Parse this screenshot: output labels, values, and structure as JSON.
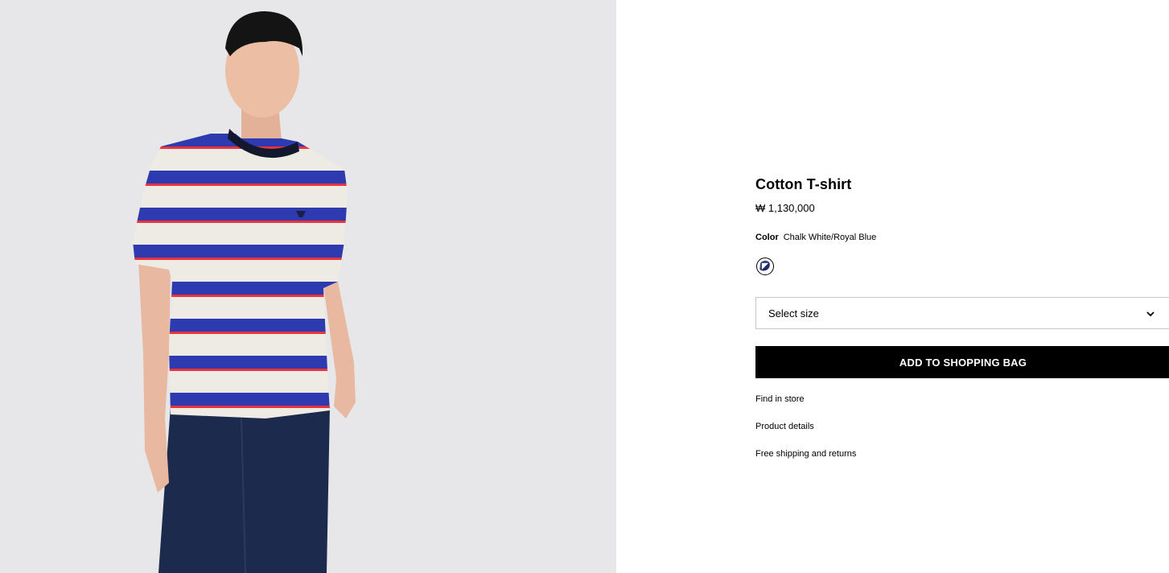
{
  "product": {
    "name": "Cotton T-shirt",
    "price": "₩ 1,130,000",
    "color_label": "Color",
    "color_value": "Chalk White/Royal Blue",
    "swatch_icon": "color-swatch-icon",
    "swatch_colors": [
      "#ffffff",
      "#1f2a6b"
    ]
  },
  "size_select": {
    "placeholder": "Select size",
    "icon": "chevron-down-icon"
  },
  "actions": {
    "add_to_bag": "ADD TO SHOPPING BAG"
  },
  "links": {
    "find_in_store": "Find in store",
    "product_details": "Product details",
    "shipping": "Free shipping and returns"
  },
  "colors": {
    "image_bg": "#e7e7e9",
    "stripe_blue": "#2d3ab0",
    "stripe_red": "#e8323c",
    "stripe_white": "#eeeae4",
    "denim": "#1c2a4d"
  }
}
